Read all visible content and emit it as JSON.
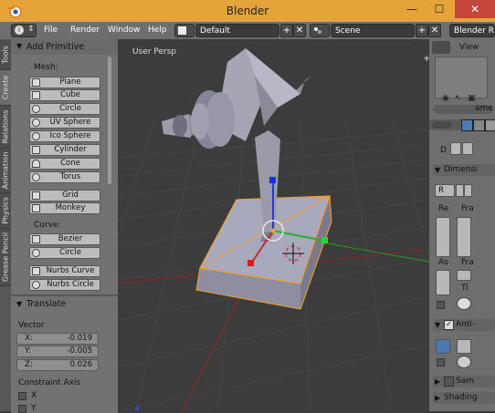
{
  "window": {
    "title": "Blender"
  },
  "header": {
    "menus": [
      "File",
      "Render",
      "Window",
      "Help"
    ],
    "layout": "Default",
    "scene": "Scene",
    "engine": "Blender R",
    "info_icon": "info-icon"
  },
  "tabs": [
    "Tools",
    "Create",
    "Relations",
    "Animation",
    "Physics",
    "Grease Pencil"
  ],
  "tool_shelf": {
    "panel_title": "Add Primitive",
    "mesh_label": "Mesh:",
    "mesh_items": [
      "Plane",
      "Cube",
      "Circle",
      "UV Sphere",
      "Ico Sphere",
      "Cylinder",
      "Cone",
      "Torus"
    ],
    "extra_items": [
      "Grid",
      "Monkey"
    ],
    "curve_label": "Curve:",
    "curve_items": [
      "Bezier",
      "Circle"
    ],
    "nurbs_items": [
      "Nurbs Curve",
      "Nurbs Circle"
    ]
  },
  "operator": {
    "title": "Translate",
    "vector_label": "Vector",
    "x_label": "X:",
    "x_value": "-0.019",
    "y_label": "Y:",
    "y_value": "-0.005",
    "z_label": "Z:",
    "z_value": "0.026",
    "constraint_label": "Constraint Axis",
    "constraint_x": "X",
    "constraint_y": "Y"
  },
  "viewport": {
    "label": "User Persp"
  },
  "outliner": {
    "view_label": "View",
    "name_partial": "ame"
  },
  "properties": {
    "d_label": "D",
    "dimensions": "Dimensi",
    "r_label": "R",
    "res_label": "Re",
    "fra_label": "Fra",
    "as_label": "As",
    "fra2_label": "Fra",
    "ti_label": "Ti",
    "anti": "Anti-",
    "sam": "Sam",
    "shading": "Shading"
  },
  "colors": {
    "title_bar": "#e4a43a",
    "close_button": "#c7463c",
    "panel_bg": "#727272",
    "viewport_bg": "#3c3c3c",
    "selection_orange": "#f0a030"
  }
}
